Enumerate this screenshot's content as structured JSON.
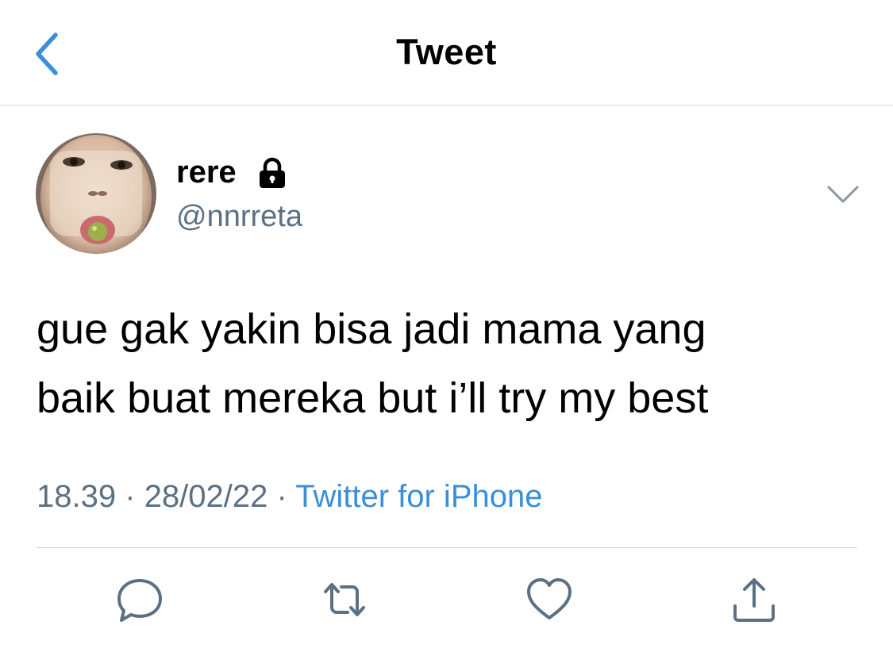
{
  "header": {
    "title": "Tweet",
    "back_icon": "chevron-left-icon"
  },
  "tweet": {
    "author": {
      "name": "rere",
      "handle": "@nnrreta",
      "protected_icon": "lock-icon"
    },
    "text_lines": [
      "gue gak yakin bisa jadi mama yang",
      "baik buat mereka but i’ll try my best"
    ],
    "time": "18.39",
    "date": "28/02/22",
    "separator": "·",
    "source": "Twitter for iPhone",
    "more_icon": "chevron-down-icon"
  },
  "actions": [
    "reply-icon",
    "retweet-icon",
    "like-icon",
    "share-icon"
  ],
  "colors": {
    "accent": "#3a8fd9",
    "secondary_text": "#5b7083",
    "divider": "#d6d7d9",
    "icon": "#5b7083"
  }
}
